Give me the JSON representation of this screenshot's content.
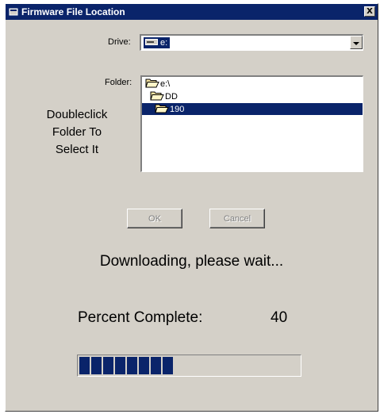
{
  "window": {
    "title": "Firmware File Location",
    "close_label": "X"
  },
  "drive": {
    "label": "Drive:",
    "value": "e:"
  },
  "folder": {
    "label": "Folder:",
    "items": [
      {
        "label": "e:\\",
        "icon": "open-folder-icon",
        "selected": false
      },
      {
        "label": "DD",
        "icon": "open-folder-icon",
        "selected": false
      },
      {
        "label": "190",
        "icon": "open-folder-icon",
        "selected": true
      }
    ]
  },
  "instruction": {
    "line1": "Doubleclick",
    "line2": "Folder To",
    "line3": "Select It"
  },
  "buttons": {
    "ok_label": "OK",
    "cancel_label": "Cancel"
  },
  "status": {
    "message": "Downloading, please wait...",
    "percent_label": "Percent Complete:",
    "percent_value": "40"
  },
  "progress": {
    "fraction": 0.4
  },
  "colors": {
    "titlebar": "#0a246a",
    "window_face": "#d4d0c8",
    "selection": "#0a246a",
    "progress_fill": "#0a246a"
  }
}
